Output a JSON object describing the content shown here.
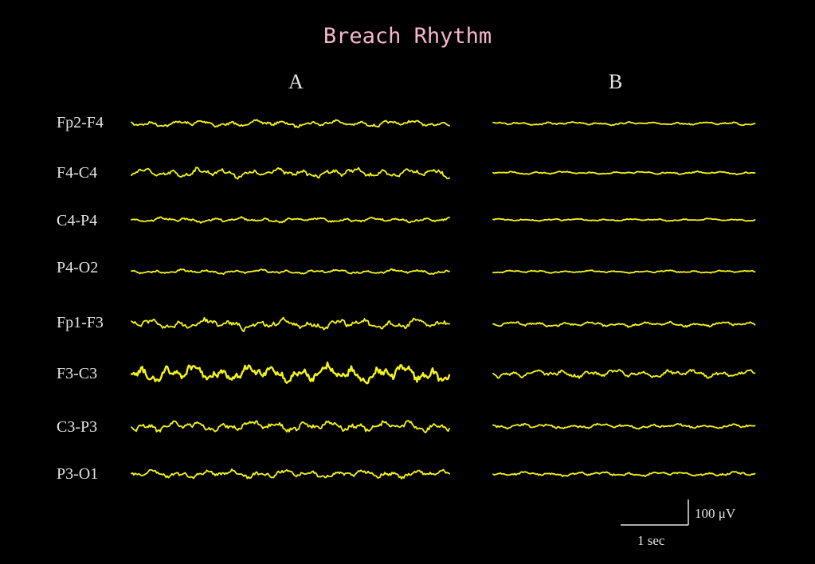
{
  "title": "Breach Rhythm",
  "columns": [
    {
      "label": "A"
    },
    {
      "label": "B"
    }
  ],
  "channels": [
    {
      "label": "Fp2-F4",
      "amp_a": 1.2,
      "amp_b": 0.6
    },
    {
      "label": "F4-C4",
      "amp_a": 1.7,
      "amp_b": 0.55
    },
    {
      "label": "C4-P4",
      "amp_a": 0.9,
      "amp_b": 0.45
    },
    {
      "label": "P4-O2",
      "amp_a": 0.8,
      "amp_b": 0.5
    },
    {
      "label": "Fp1-F3",
      "amp_a": 2.0,
      "amp_b": 0.9
    },
    {
      "label": "F3-C3",
      "amp_a": 3.2,
      "amp_b": 1.4
    },
    {
      "label": "C3-P3",
      "amp_a": 2.0,
      "amp_b": 0.9
    },
    {
      "label": "P3-O1",
      "amp_a": 1.5,
      "amp_b": 0.8
    }
  ],
  "scale_bar": {
    "amplitude_label": "100 μV",
    "time_label": "1 sec"
  },
  "colors": {
    "background": "#000000",
    "trace": "#f5f518",
    "title": "#f6b8cf",
    "text": "#e6e6e6"
  }
}
